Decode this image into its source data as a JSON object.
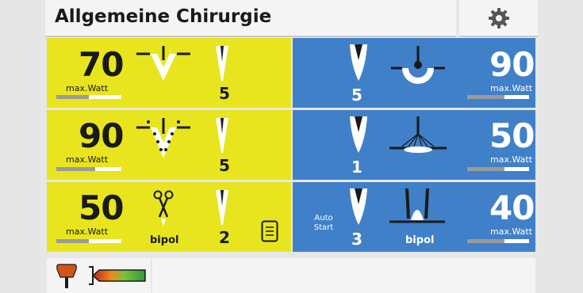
{
  "header": {
    "title": "Allgemeine Chirurgie"
  },
  "icons": {
    "settings": "gear-icon"
  },
  "colors": {
    "yellow": "#e8e51f",
    "blue": "#4080c8",
    "pedal": "#d3541a"
  },
  "rows": [
    {
      "cut": {
        "watt": "70",
        "max_label": "max.Watt",
        "level": 0.5,
        "effect": "5"
      },
      "coag": {
        "watt": "90",
        "max_label": "max.Watt",
        "level": 0.6,
        "effect": "5"
      }
    },
    {
      "cut": {
        "watt": "90",
        "max_label": "max.Watt",
        "level": 0.6,
        "effect": "5"
      },
      "coag": {
        "watt": "50",
        "max_label": "max.Watt",
        "level": 0.6,
        "effect": "1"
      }
    },
    {
      "cut": {
        "watt": "50",
        "max_label": "max.Watt",
        "level": 0.5,
        "effect": "2",
        "mode_label": "bipol"
      },
      "coag": {
        "watt": "40",
        "max_label": "max.Watt",
        "level": 0.6,
        "effect": "3",
        "mode_label": "bipol",
        "auto_start": "Auto\nStart"
      }
    }
  ],
  "footer": {
    "pedal_icon": "foot-pedal-icon",
    "power_meter_icon": "power-meter-icon"
  }
}
